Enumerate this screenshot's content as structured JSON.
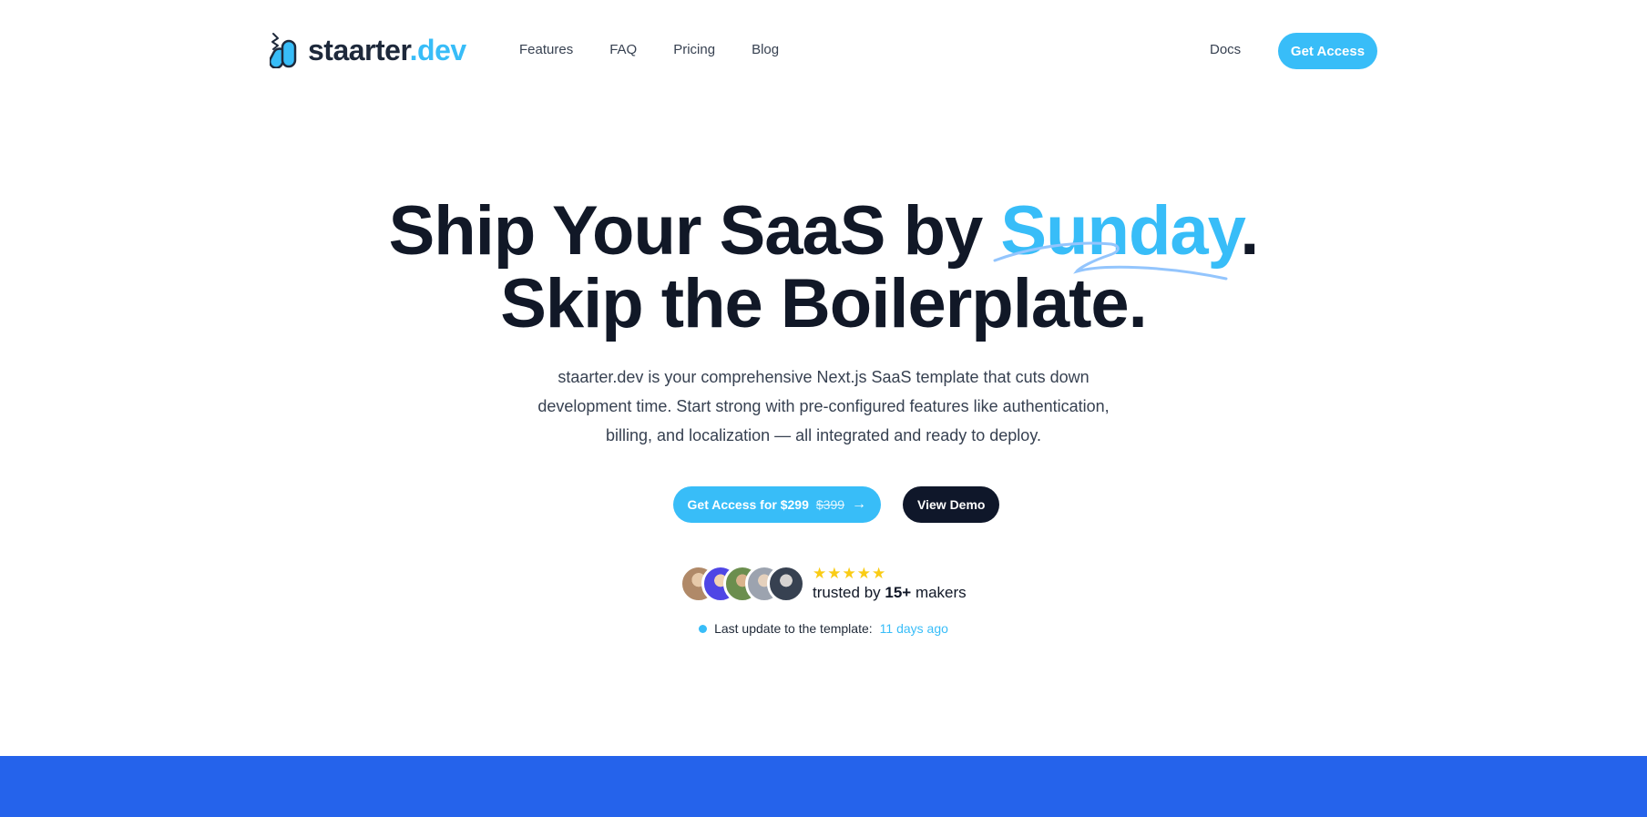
{
  "brand": {
    "name_main": "staarter",
    "name_accent": ".dev"
  },
  "nav": {
    "links": [
      "Features",
      "FAQ",
      "Pricing",
      "Blog"
    ],
    "docs": "Docs",
    "cta": "Get Access"
  },
  "hero": {
    "title_line1_prefix": "Ship Your SaaS by ",
    "title_highlight": "Sunday",
    "title_line1_suffix": ".",
    "title_line2": "Skip the Boilerplate.",
    "subtitle": "staarter.dev is your comprehensive Next.js SaaS template that cuts down development time. Start strong with pre-configured features like authentication, billing, and localization — all integrated and ready to deploy."
  },
  "cta": {
    "primary_label": "Get Access for $299",
    "primary_old_price": "$399",
    "primary_arrow": "→",
    "secondary_label": "View Demo"
  },
  "social_proof": {
    "stars": "★★★★★",
    "trusted_prefix": "trusted by ",
    "trusted_count": "15+",
    "trusted_suffix": " makers",
    "avatar_colors": [
      "#b08968",
      "#4f46e5",
      "#6b8e4e",
      "#9ca3af",
      "#374151"
    ]
  },
  "update": {
    "label": "Last update to the template:",
    "ago": "11 days ago"
  },
  "colors": {
    "accent": "#38bdf8",
    "dark": "#0f172a",
    "band": "#2563eb"
  }
}
